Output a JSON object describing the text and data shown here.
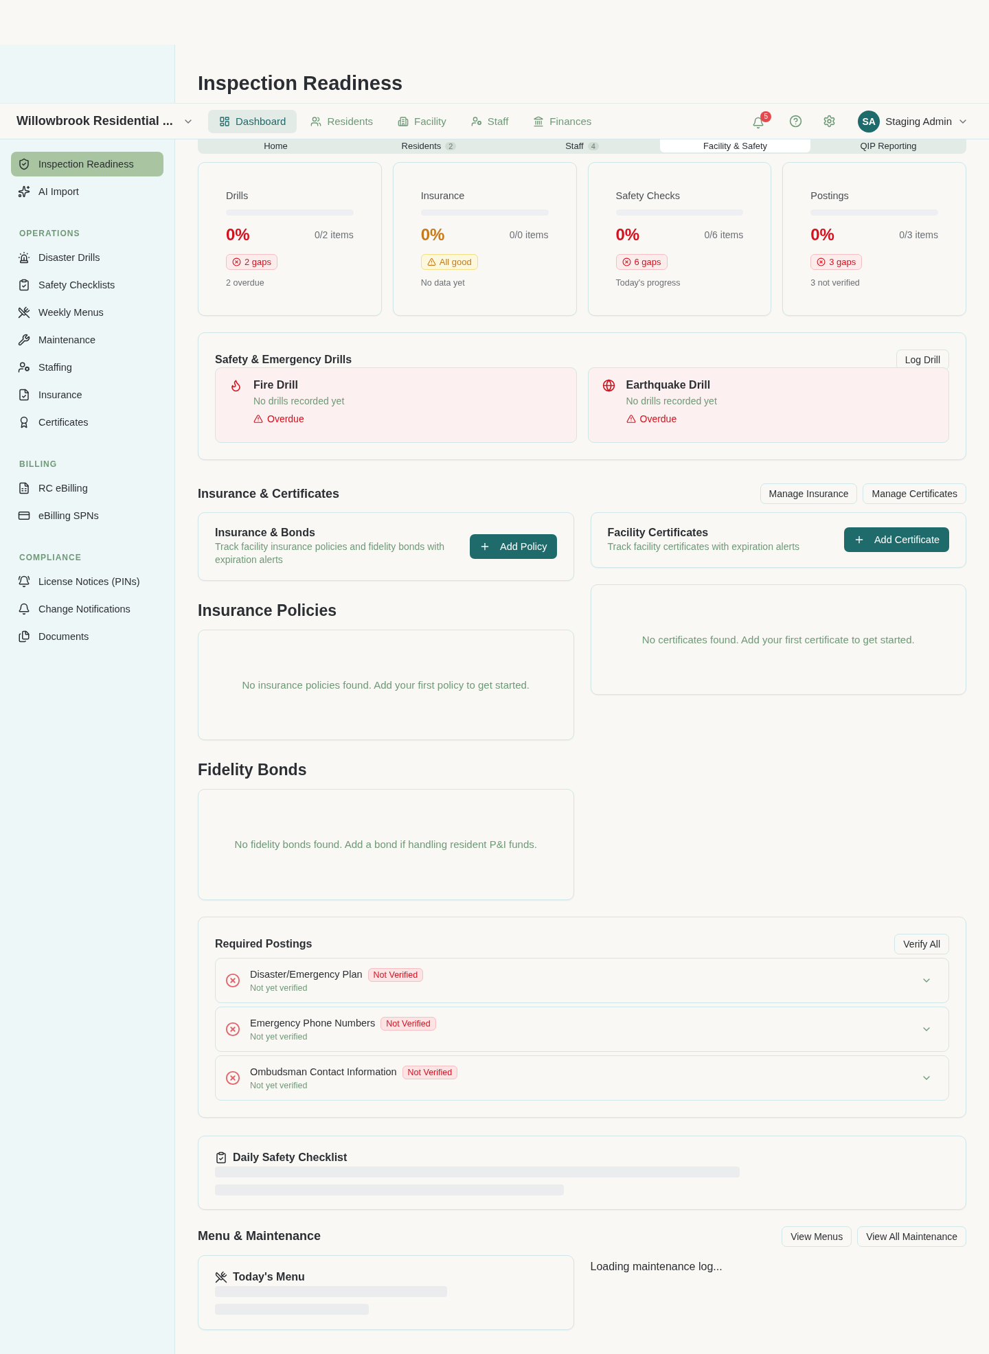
{
  "page_title": "Inspection Readiness",
  "nav": {
    "brand": "Willowbrook Residential ...",
    "tabs": [
      {
        "label": "Dashboard",
        "selected": true
      },
      {
        "label": "Residents",
        "selected": false
      },
      {
        "label": "Facility",
        "selected": false
      },
      {
        "label": "Staff",
        "selected": false
      },
      {
        "label": "Finances",
        "selected": false
      }
    ],
    "notifications": "5",
    "user": {
      "initials": "SA",
      "name": "Staging Admin"
    }
  },
  "subtabs": [
    {
      "label": "Home",
      "selected": false
    },
    {
      "label": "Residents",
      "count": "2",
      "selected": false
    },
    {
      "label": "Staff",
      "count": "4",
      "selected": false
    },
    {
      "label": "Facility & Safety",
      "selected": true
    },
    {
      "label": "QIP Reporting",
      "selected": false
    }
  ],
  "sidebar": {
    "items": [
      {
        "label": "Inspection Readiness",
        "selected": true
      },
      {
        "label": "AI Import",
        "selected": false
      }
    ],
    "sections": [
      {
        "title": "OPERATIONS",
        "items": [
          {
            "label": "Disaster Drills",
            "selected": false
          },
          {
            "label": "Safety Checklists",
            "selected": false
          },
          {
            "label": "Weekly Menus",
            "selected": false
          },
          {
            "label": "Maintenance",
            "selected": false
          },
          {
            "label": "Staffing",
            "selected": false
          },
          {
            "label": "Insurance",
            "selected": false
          },
          {
            "label": "Certificates",
            "selected": false
          }
        ]
      },
      {
        "title": "BILLING",
        "items": [
          {
            "label": "RC eBilling",
            "selected": false
          },
          {
            "label": "eBilling SPNs",
            "selected": false
          }
        ]
      },
      {
        "title": "COMPLIANCE",
        "items": [
          {
            "label": "License Notices (PINs)",
            "selected": false
          },
          {
            "label": "Change Notifications",
            "selected": false
          },
          {
            "label": "Documents",
            "selected": false
          }
        ]
      }
    ]
  },
  "stats": [
    {
      "label": "Drills",
      "level": 0,
      "percent": "0%",
      "items": "0/2 items",
      "kind": "gaps",
      "badge": "2 gaps",
      "note": "2 overdue"
    },
    {
      "label": "Insurance",
      "level": 0,
      "percent": "0%",
      "items": "0/0 items",
      "kind": "ok",
      "badge": "All good",
      "note": "No data yet"
    },
    {
      "label": "Safety Checks",
      "level": 0,
      "percent": "0%",
      "items": "0/6 items",
      "kind": "gaps",
      "badge": "6 gaps",
      "note": "Today's progress"
    },
    {
      "label": "Postings",
      "level": 0,
      "percent": "0%",
      "items": "0/3 items",
      "kind": "gaps",
      "badge": "3 gaps",
      "note": "3 not verified"
    }
  ],
  "drills": {
    "title": "Safety & Emergency Drills",
    "button": "Log Drill",
    "items": [
      {
        "name": "Fire Drill",
        "detail": "No drills recorded yet",
        "status": "Overdue",
        "overdue": true
      },
      {
        "name": "Earthquake Drill",
        "detail": "No drills recorded yet",
        "status": "Overdue",
        "overdue": true
      }
    ]
  },
  "insurance": {
    "title": "Insurance & Certificates",
    "buttons": [
      "Manage Insurance",
      "Manage Certificates"
    ],
    "bonds_card": {
      "title": "Insurance & Bonds",
      "description": "Track facility insurance policies and fidelity bonds with expiration alerts",
      "button": "Add Policy"
    },
    "certificates_card": {
      "title": "Facility Certificates",
      "description": "Track facility certificates with expiration alerts",
      "button": "Add Certificate"
    },
    "policies": {
      "title": "Insurance Policies",
      "empty": "No insurance policies found. Add your first policy to get started."
    },
    "bonds": {
      "title": "Fidelity Bonds",
      "empty": "No fidelity bonds found. Add a bond if handling resident P&I funds."
    },
    "certificates": {
      "empty": "No certificates found. Add your first certificate to get started."
    }
  },
  "postings": {
    "title": "Required Postings",
    "button": "Verify All",
    "items": [
      {
        "name": "Disaster/Emergency Plan",
        "verified": false,
        "badge": "Not Verified",
        "detail": "Not yet verified"
      },
      {
        "name": "Emergency Phone Numbers",
        "verified": false,
        "badge": "Not Verified",
        "detail": "Not yet verified"
      },
      {
        "name": "Ombudsman Contact Information",
        "verified": false,
        "badge": "Not Verified",
        "detail": "Not yet verified"
      }
    ]
  },
  "checklist": {
    "title": "Daily Safety Checklist"
  },
  "menu_maintenance": {
    "title": "Menu & Maintenance",
    "buttons": [
      "View Menus",
      "View All Maintenance"
    ],
    "menu_title": "Today's Menu",
    "maintenance": "Loading maintenance log..."
  }
}
